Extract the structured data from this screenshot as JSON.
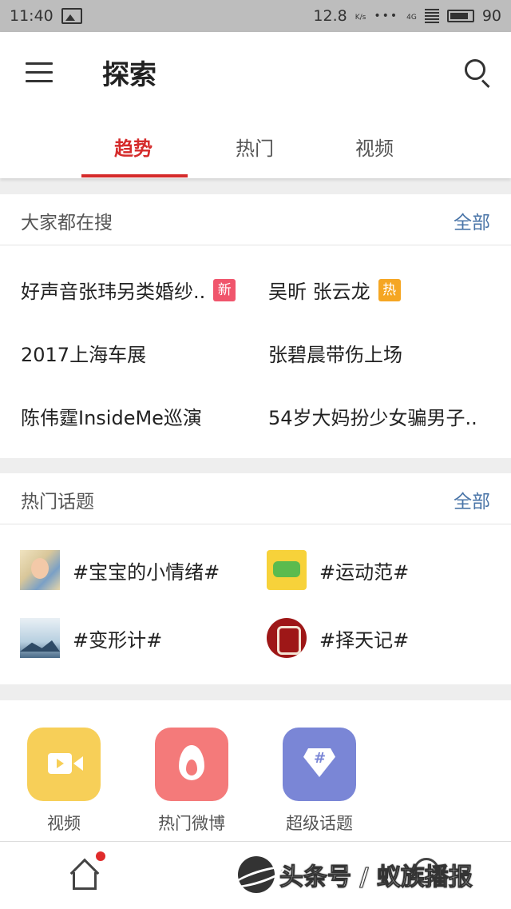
{
  "status_bar": {
    "time": "11:40",
    "speed": "12.8",
    "speed_unit": "K/s",
    "network": "4G",
    "battery": "90"
  },
  "header": {
    "title": "探索",
    "tabs": [
      {
        "label": "趋势",
        "active": true
      },
      {
        "label": "热门",
        "active": false
      },
      {
        "label": "视频",
        "active": false
      }
    ]
  },
  "trending": {
    "title": "大家都在搜",
    "more": "全部",
    "items": [
      {
        "text": "好声音张玮另类婚纱..",
        "badge": "新"
      },
      {
        "text": "吴昕 张云龙",
        "badge": "热"
      },
      {
        "text": "2017上海车展",
        "badge": ""
      },
      {
        "text": "张碧晨带伤上场",
        "badge": ""
      },
      {
        "text": "陈伟霆InsideMe巡演",
        "badge": ""
      },
      {
        "text": "54岁大妈扮少女骗男子..",
        "badge": ""
      }
    ]
  },
  "topics": {
    "title": "热门话题",
    "more": "全部",
    "items": [
      {
        "label": "#宝宝的小情绪#"
      },
      {
        "label": "#运动范#"
      },
      {
        "label": "#变形计#"
      },
      {
        "label": "#择天记#"
      }
    ]
  },
  "shortcuts": [
    {
      "label": "视频",
      "color": "#f7cf58"
    },
    {
      "label": "热门微博",
      "color": "#f47a7a"
    },
    {
      "label": "超级话题",
      "color": "#7a86d6"
    }
  ],
  "watermark": "头条号 / 蚁族播报",
  "colors": {
    "accent": "#d52b2b",
    "link": "#4a75a8",
    "badge_new": "#f0556c",
    "badge_hot": "#f5a623"
  }
}
